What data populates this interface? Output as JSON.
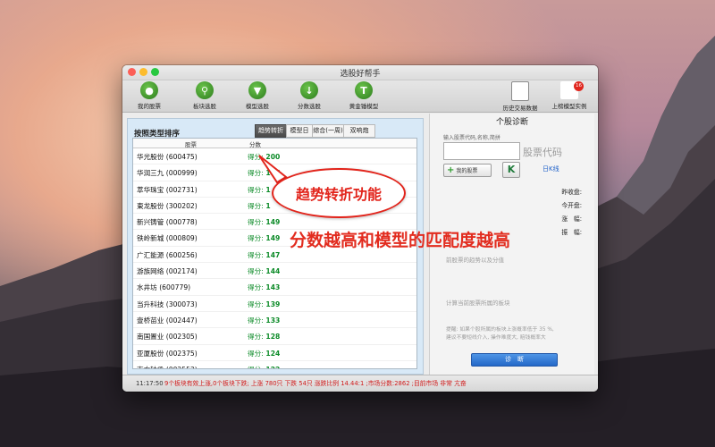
{
  "window": {
    "title": "选股好帮手"
  },
  "toolbar": {
    "my_stocks": "我的股票",
    "sector_pick": "板块选股",
    "model_pick": "模型选股",
    "score_pick": "分数选股",
    "golden_hammer": "黄金锤模型",
    "history_data": "历史交易数据",
    "top_models": "上榜模型实例",
    "top_models_badge": "16"
  },
  "left_panel": {
    "title": "按照类型排序",
    "tabs": [
      "趋势转折",
      "模型日",
      "综合(一周)",
      "双响炮"
    ],
    "active_tab": 0,
    "columns": {
      "stock": "股票",
      "score": "分数"
    },
    "score_prefix": "得分:",
    "rows": [
      {
        "name": "华光股份 (600475)",
        "score": "200"
      },
      {
        "name": "华润三九 (000999)",
        "score": "167"
      },
      {
        "name": "萃华珠宝 (002731)",
        "score": "1"
      },
      {
        "name": "東龙股份 (300202)",
        "score": "1"
      },
      {
        "name": "新兴铸管 (000778)",
        "score": "149"
      },
      {
        "name": "铁岭新城 (000809)",
        "score": "149"
      },
      {
        "name": "广汇能源 (600256)",
        "score": "147"
      },
      {
        "name": "游族网络 (002174)",
        "score": "144"
      },
      {
        "name": "水井坊 (600779)",
        "score": "143"
      },
      {
        "name": "当升科技 (300073)",
        "score": "139"
      },
      {
        "name": "壹桥苗业 (002447)",
        "score": "133"
      },
      {
        "name": "南国置业 (002305)",
        "score": "128"
      },
      {
        "name": "亚厦股份 (002375)",
        "score": "124"
      },
      {
        "name": "南方轴承 (002553)",
        "score": "122"
      },
      {
        "name": "泰格医药 (300347)",
        "score": "107"
      }
    ]
  },
  "right_panel": {
    "title": "个股诊断",
    "input_hint": "输入股票代码,名称,简拼",
    "code_label": "股票代码",
    "my_stock_button": "我的股票",
    "k_button": "K",
    "k_line": "日K线",
    "prev_close": "昨收盘:",
    "open_today": "今开盘:",
    "change": "涨　幅:",
    "amplitude": "振　幅:",
    "diagnosis_text": "前股票的趋势以及分值",
    "sector_text": "计算当前股票所属的板块",
    "tip_text_1": "提醒: 如果个股所属的板块上涨概率低于 35 %,",
    "tip_text_2": "建议不要短线介入, 操作难度大, 赔钱概率大",
    "diagnose_button": "诊　断"
  },
  "status": {
    "time": "11:17:50",
    "text": "9个板块有效上涨,0个板块下跌; 上涨 780只 下跌 54只 涨跌比例 14.44:1 ;市场分数:2862 ;目前市场 非常 亢奋"
  },
  "callouts": {
    "bubble": "趋势转折功能",
    "overlay": "分数越高和模型的匹配度越高"
  },
  "colors": {
    "accent_red": "#e2241b",
    "score_green": "#0a8a26",
    "tab_active": "#4a4a4a"
  }
}
